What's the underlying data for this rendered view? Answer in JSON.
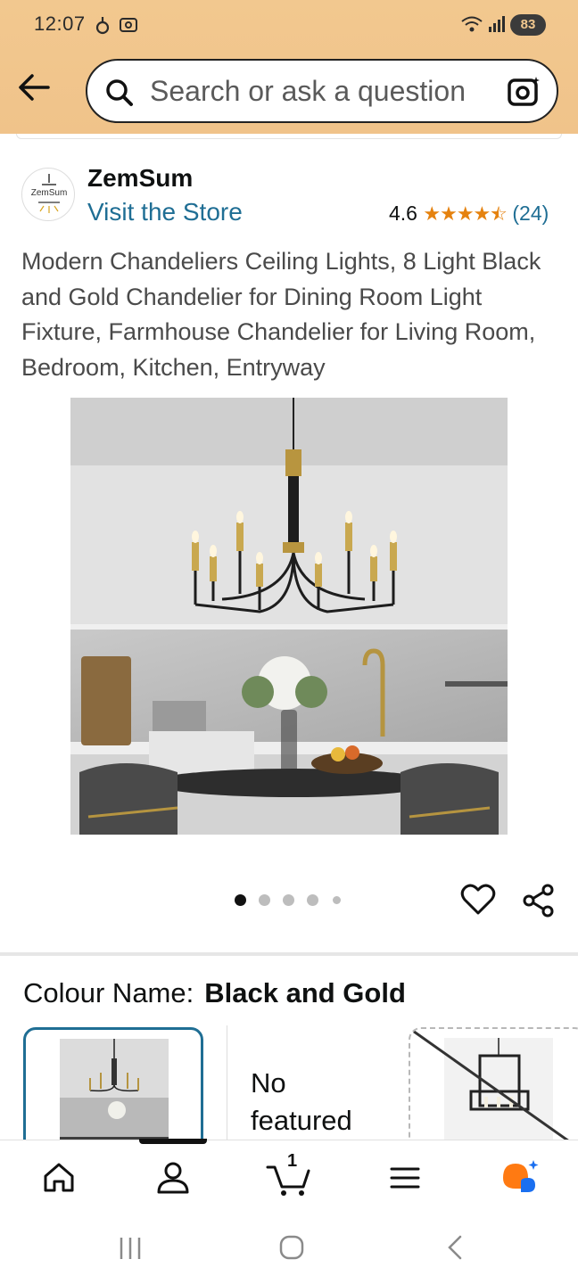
{
  "status_bar": {
    "time": "12:07",
    "battery": "83"
  },
  "search": {
    "placeholder": "Search or ask a question"
  },
  "brand": {
    "name": "ZemSum",
    "logo_text": "ZemSum",
    "store_link": "Visit the Store"
  },
  "rating": {
    "value": "4.6",
    "stars": 4.5,
    "count": "(24)"
  },
  "product": {
    "title": "Modern Chandeliers Ceiling Lights, 8 Light Black and Gold Chandelier for Dining Room Light Fixture, Farmhouse Chandelier for Living Room, Bedroom, Kitchen, Entryway"
  },
  "carousel": {
    "dots": 5,
    "active_index": 0
  },
  "colour": {
    "label": "Colour Name:",
    "value": "Black and Gold",
    "option2_text_line1": "No",
    "option2_text_line2": "featured"
  },
  "bottom_nav": {
    "items": [
      "home-icon",
      "account-icon",
      "cart-icon",
      "menu-icon",
      "rufus-icon"
    ],
    "cart_count": "1",
    "active_index": 1
  },
  "colors": {
    "header_bg": "#f2c88f",
    "link": "#1f6e94",
    "star": "#e5820f",
    "selected_border": "#1f6e94"
  }
}
